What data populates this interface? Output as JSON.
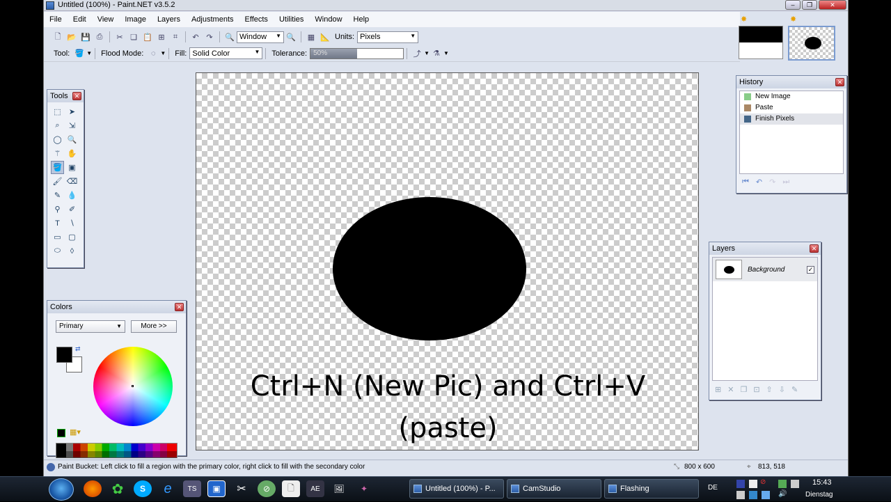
{
  "window": {
    "title": "Untitled (100%) - Paint.NET v3.5.2"
  },
  "menu": [
    "File",
    "Edit",
    "View",
    "Image",
    "Layers",
    "Adjustments",
    "Effects",
    "Utilities",
    "Window",
    "Help"
  ],
  "toolbar": {
    "zoom_value": "Window",
    "units_label": "Units:",
    "units_value": "Pixels"
  },
  "tool_options": {
    "tool_label": "Tool:",
    "flood_label": "Flood Mode:",
    "fill_label": "Fill:",
    "fill_value": "Solid Color",
    "tolerance_label": "Tolerance:",
    "tolerance_value": "50%",
    "tolerance_fraction": 0.5
  },
  "canvas": {
    "caption_line1": "Ctrl+N (New Pic) and Ctrl+V",
    "caption_line2": "(paste)"
  },
  "tools_panel": {
    "title": "Tools"
  },
  "history": {
    "title": "History",
    "items": [
      "New Image",
      "Paste",
      "Finish Pixels"
    ]
  },
  "layers": {
    "title": "Layers",
    "items": [
      {
        "name": "Background",
        "visible": true
      }
    ]
  },
  "colors": {
    "title": "Colors",
    "mode": "Primary",
    "more_button": "More >>"
  },
  "status": {
    "hint": "Paint Bucket: Left click to fill a region with the primary color, right click to fill with the secondary color",
    "size": "800 x 600",
    "position": "813, 518"
  },
  "taskbar": {
    "tasks": [
      "Untitled (100%) - P...",
      "CamStudio",
      "Flashing"
    ],
    "lang": "DE",
    "time": "15:43",
    "day": "Dienstag"
  }
}
